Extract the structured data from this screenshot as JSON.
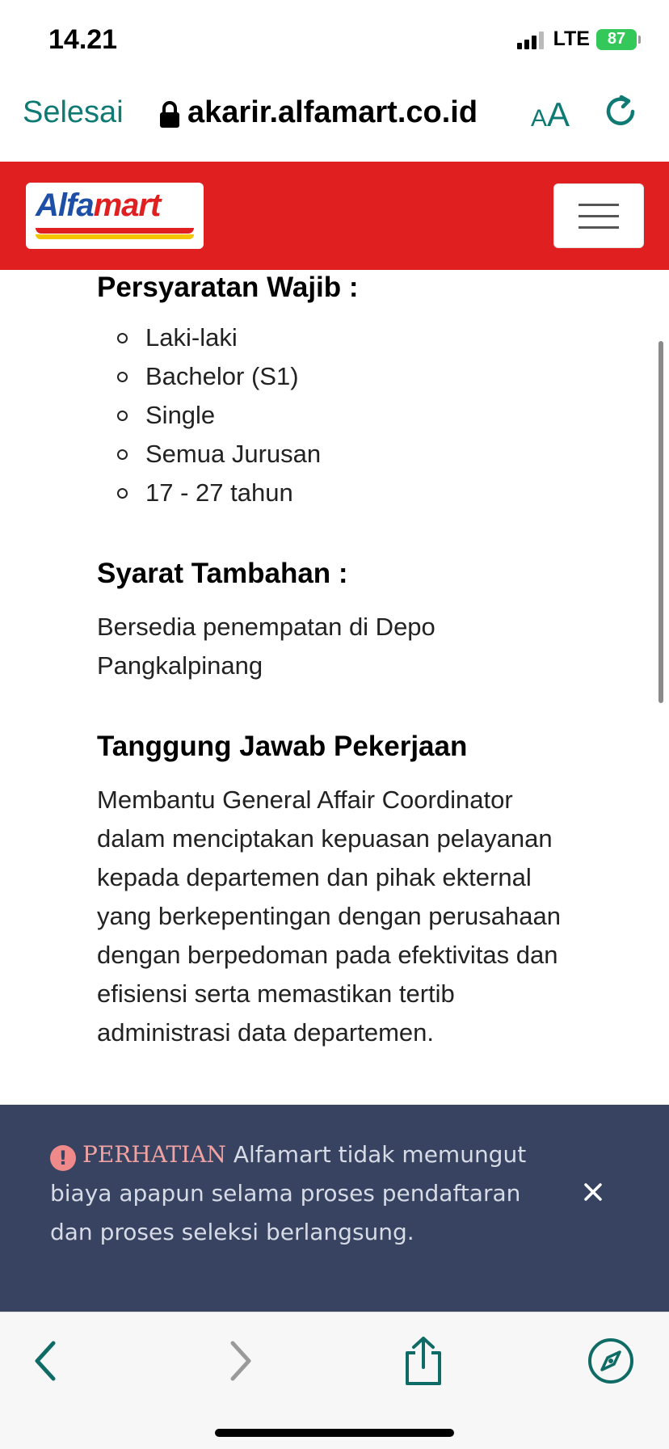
{
  "status_bar": {
    "time": "14.21",
    "network": "LTE",
    "battery": "87"
  },
  "browser": {
    "done_label": "Selesai",
    "url": "akarir.alfamart.co.id",
    "text_size_label_small": "A",
    "text_size_label_large": "A"
  },
  "site": {
    "logo_alfa": "Alfa",
    "logo_mart": "mart",
    "brand_colors": {
      "red": "#e02020",
      "blue": "#1d4fa6",
      "yellow": "#f5c400"
    }
  },
  "content": {
    "requirements_title": "Persyaratan Wajib :",
    "requirements": [
      "Laki-laki",
      "Bachelor (S1)",
      "Single",
      "Semua Jurusan",
      "17 - 27 tahun"
    ],
    "extra_title": "Syarat Tambahan :",
    "extra_text": "Bersedia penempatan di Depo Pangkalpinang",
    "responsibility_title": "Tanggung Jawab Pekerjaan",
    "responsibility_text": "Membantu General Affair Coordinator dalam menciptakan kepuasan pelayanan kepada departemen dan pihak ekternal yang berkepentingan dengan perusahaan dengan berpedoman pada efektivitas dan efisiensi serta memastikan tertib administrasi data departemen."
  },
  "notice": {
    "icon": "!",
    "title": "PERHATIAN",
    "text": " Alfamart tidak memungut biaya apapun selama proses pendaftaran dan proses seleksi berlangsung."
  },
  "toolbar": {
    "icons": [
      "back-icon",
      "forward-icon",
      "share-icon",
      "compass-icon"
    ]
  }
}
